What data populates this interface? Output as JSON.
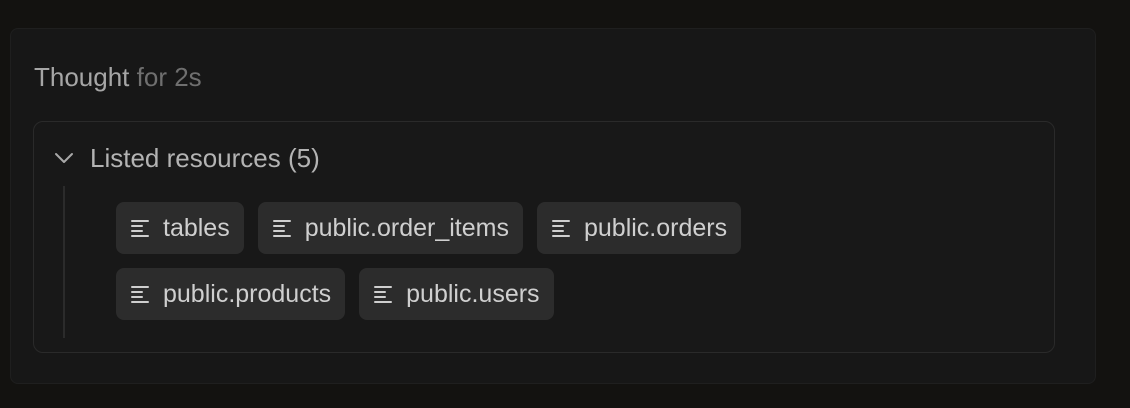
{
  "thought": {
    "label": "Thought",
    "duration": "for 2s"
  },
  "resources": {
    "title": "Listed resources (5)",
    "icon": "chevron-down-icon",
    "items": [
      {
        "label": "tables",
        "icon": "text-lines-icon"
      },
      {
        "label": "public.order_items",
        "icon": "text-lines-icon"
      },
      {
        "label": "public.orders",
        "icon": "text-lines-icon"
      },
      {
        "label": "public.products",
        "icon": "text-lines-icon"
      },
      {
        "label": "public.users",
        "icon": "text-lines-icon"
      }
    ]
  },
  "colors": {
    "background": "#131210",
    "panel": "#171717",
    "chip": "#2c2c2c",
    "text_primary": "#cfcfcf",
    "text_muted": "#6f6f6f"
  }
}
